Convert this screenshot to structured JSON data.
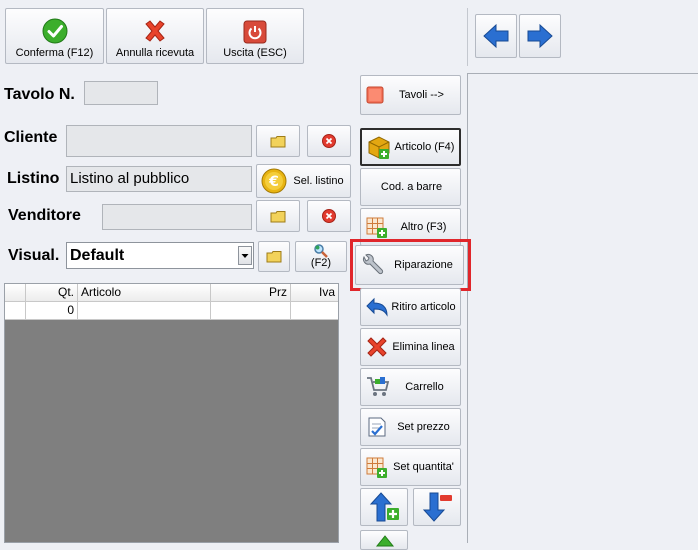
{
  "toolbar": {
    "confirm_label": "Conferma (F12)",
    "cancel_label": "Annulla ricevuta",
    "exit_label": "Uscita (ESC)"
  },
  "form": {
    "table_label": "Tavolo N.",
    "table_value": "",
    "customer_label": "Cliente",
    "customer_value": "",
    "price_list_label": "Listino",
    "price_list_value": "Listino al pubblico",
    "select_price_list_label": "Sel. listino",
    "seller_label": "Venditore",
    "seller_value": "",
    "view_label": "Visual.",
    "view_value": "Default",
    "f2_label": "(F2)"
  },
  "grid": {
    "columns": [
      "Qt.",
      "Articolo",
      "Prz",
      "Iva"
    ],
    "rows": [
      {
        "qty": "0",
        "article": "",
        "price": "",
        "vat": ""
      }
    ]
  },
  "actions": {
    "tables_label": "Tavoli -->",
    "article_label": "Articolo (F4)",
    "barcode_label": "Cod. a barre",
    "other_label": "Altro (F3)",
    "repair_label": "Riparazione",
    "return_label": "Ritiro articolo",
    "delete_line_label": "Elimina linea",
    "cart_label": "Carrello",
    "set_price_label": "Set prezzo",
    "set_qty_label": "Set quantita'"
  },
  "colors": {
    "highlight": "#e0262b",
    "arrow_blue": "#2a6fd1",
    "confirm_green": "#3cae2c",
    "cancel_red": "#e8432b",
    "exit_red": "#d84a3a",
    "euro_gold": "#e8b412"
  }
}
